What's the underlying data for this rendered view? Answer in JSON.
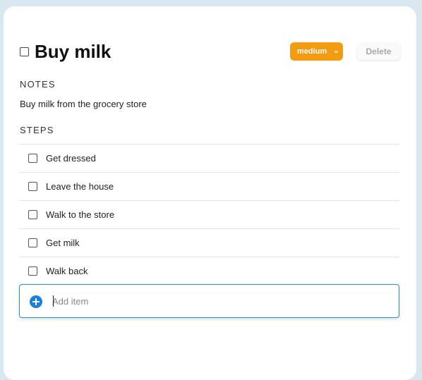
{
  "task": {
    "title": "Buy milk",
    "priority": "medium",
    "delete_label": "Delete"
  },
  "notes": {
    "label": "NOTES",
    "text": "Buy milk from the grocery store"
  },
  "steps": {
    "label": "STEPS",
    "items": [
      {
        "label": "Get dressed",
        "checked": false
      },
      {
        "label": "Leave the house",
        "checked": false
      },
      {
        "label": "Walk to the store",
        "checked": false
      },
      {
        "label": "Get milk",
        "checked": false
      },
      {
        "label": "Walk back",
        "checked": false
      }
    ]
  },
  "add_item": {
    "placeholder": "Add item",
    "value": "",
    "icon": "plus-circle-icon"
  },
  "colors": {
    "priority_bg": "#f39c12",
    "accent": "#1a7fe0",
    "focus_border": "#2a8fd0"
  }
}
